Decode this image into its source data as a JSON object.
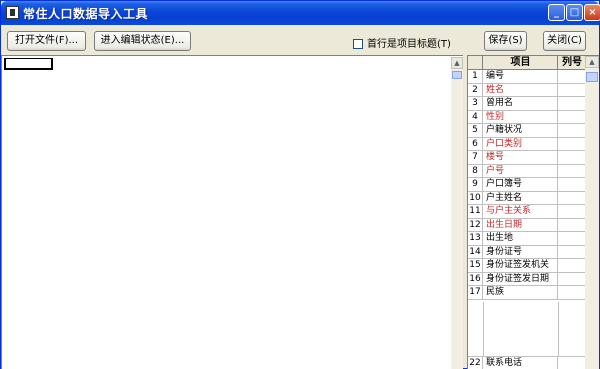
{
  "window": {
    "title": "常住人口数据导入工具",
    "controls": {
      "minimize": "_",
      "maximize": "□",
      "close": "×"
    }
  },
  "toolbar": {
    "open_file_label": "打开文件(F)...",
    "edit_state_label": "进入编辑状态(E)...",
    "first_row_title_label": "首行是项目标题(T)",
    "first_row_title_checked": false,
    "save_label": "保存(S)",
    "close_label": "关闭(C)"
  },
  "mapping_grid": {
    "headers": {
      "item": "项目",
      "column": "列号"
    },
    "rows": [
      {
        "num": "1",
        "name": "编号",
        "required": false
      },
      {
        "num": "2",
        "name": "姓名",
        "required": true
      },
      {
        "num": "3",
        "name": "曾用名",
        "required": false
      },
      {
        "num": "4",
        "name": "性别",
        "required": true
      },
      {
        "num": "5",
        "name": "户籍状况",
        "required": false
      },
      {
        "num": "6",
        "name": "户口类别",
        "required": true
      },
      {
        "num": "7",
        "name": "楼号",
        "required": true
      },
      {
        "num": "8",
        "name": "户号",
        "required": true
      },
      {
        "num": "9",
        "name": "户口簿号",
        "required": false
      },
      {
        "num": "10",
        "name": "户主姓名",
        "required": false
      },
      {
        "num": "11",
        "name": "与户主关系",
        "required": true
      },
      {
        "num": "12",
        "name": "出生日期",
        "required": true
      },
      {
        "num": "13",
        "name": "出生地",
        "required": false
      },
      {
        "num": "14",
        "name": "身份证号",
        "required": false
      },
      {
        "num": "15",
        "name": "身份证签发机关",
        "required": false
      },
      {
        "num": "16",
        "name": "身份证签发日期",
        "required": false
      },
      {
        "num": "17",
        "name": "民族",
        "required": false
      }
    ],
    "last_row": {
      "num": "22",
      "name": "联系电话"
    }
  },
  "colors": {
    "required_text": "#c0282a",
    "titlebar": "#0a46d8"
  }
}
